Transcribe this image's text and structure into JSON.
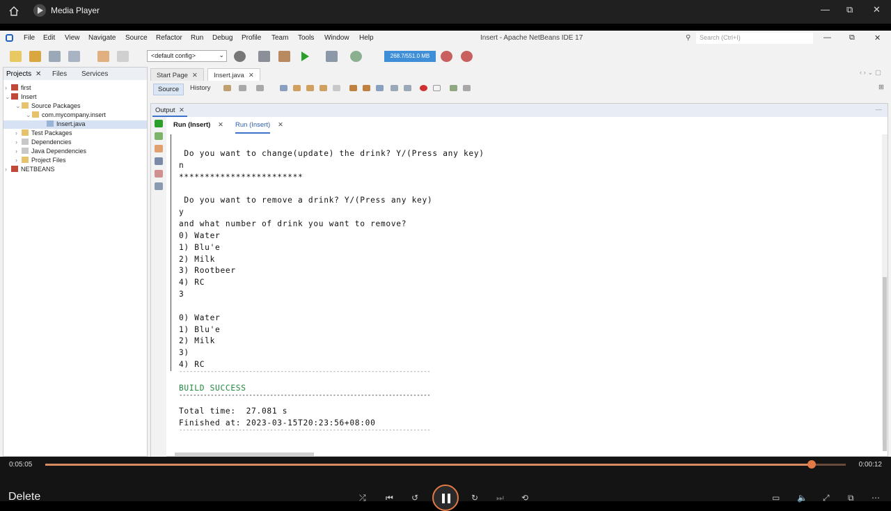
{
  "player": {
    "title": "Media Player",
    "elapsed": "0:05:05",
    "remaining": "0:00:12",
    "progress_fraction": 0.957,
    "now_playing": "Delete"
  },
  "ide": {
    "window_title": "Insert - Apache NetBeans IDE 17",
    "menu": [
      "File",
      "Edit",
      "View",
      "Navigate",
      "Source",
      "Refactor",
      "Run",
      "Debug",
      "Profile",
      "Team",
      "Tools",
      "Window",
      "Help"
    ],
    "search_placeholder": "Search (Ctrl+I)",
    "config": "<default config>",
    "memory": "268.7/551.0 MB",
    "left_tabs": [
      "Projects",
      "Files",
      "Services"
    ],
    "tree": [
      "first",
      "Insert",
      "Source Packages",
      "com.mycompany.insert",
      "Insert.java",
      "Test Packages",
      "Dependencies",
      "Java Dependencies",
      "Project Files",
      "NETBEANS"
    ],
    "editor_tabs": [
      "Start Page",
      "Insert.java"
    ],
    "editor_modes": [
      "Source",
      "History"
    ],
    "output_label": "Output",
    "output_tabs": [
      "Run (Insert)",
      "Run (Insert)"
    ],
    "console": [
      " Do you want to change(update) the drink? Y/(Press any key)",
      "n",
      "************************",
      "",
      " Do you want to remove a drink? Y/(Press any key)",
      "y",
      "and what number of drink you want to remove?",
      "0) Water",
      "1) Blu'e",
      "2) Milk",
      "3) Rootbeer",
      "4) RC",
      "3",
      "",
      "0) Water",
      "1) Blu'e",
      "2) Milk",
      "3)",
      "4) RC",
      "------------------------------------------------------------------------",
      "BUILD SUCCESS",
      "------------------------------------------------------------------------",
      "Total time:  27.081 s",
      "Finished at: 2023-03-15T20:23:56+08:00",
      "------------------------------------------------------------------------"
    ]
  }
}
